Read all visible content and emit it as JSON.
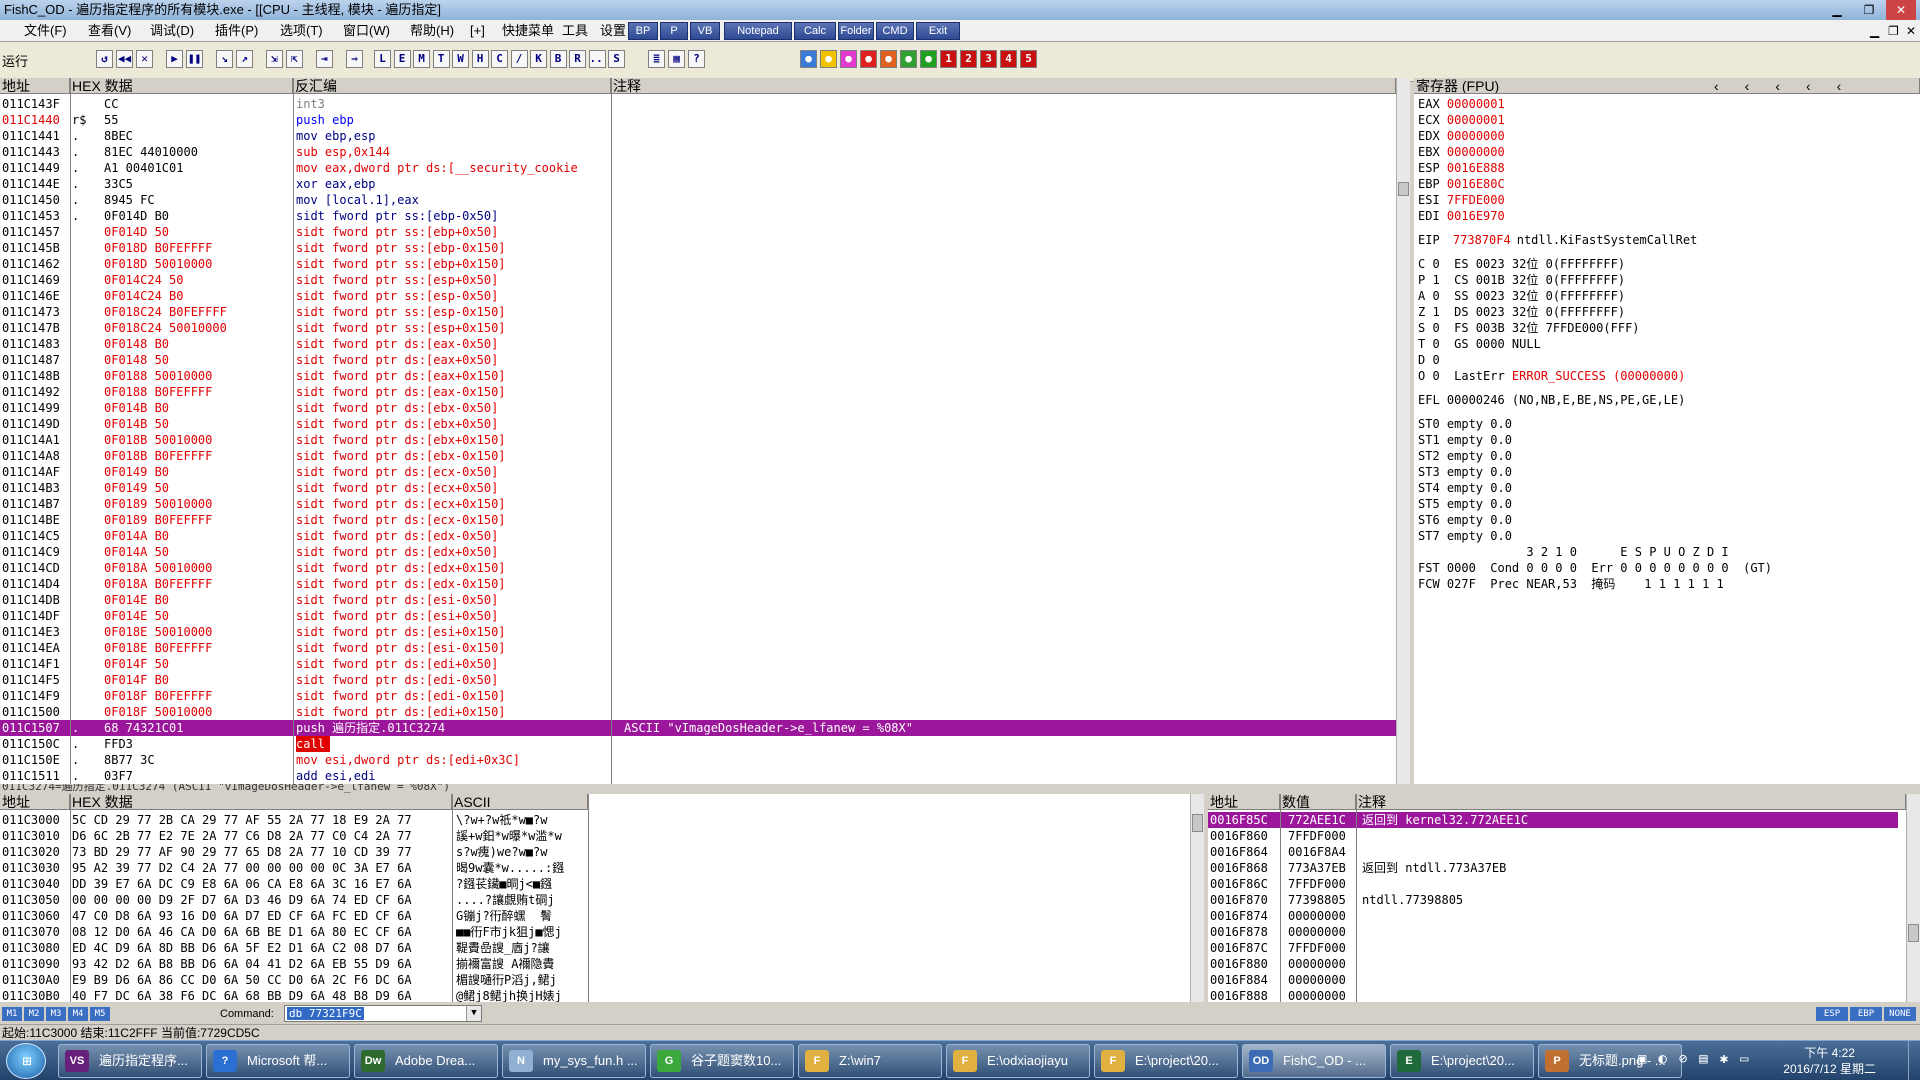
{
  "window": {
    "title": "FishC_OD - 遍历指定程序的所有模块.exe - [[CPU - 主线程, 模块 - 遍历指定]"
  },
  "menu": {
    "items": [
      "文件(F)",
      "查看(V)",
      "调试(D)",
      "插件(P)",
      "选项(T)",
      "窗口(W)",
      "帮助(H)",
      "[+]",
      "快捷菜单",
      "工具",
      "设置"
    ],
    "quick": [
      "BP",
      "P",
      "VB",
      "Notepad",
      "Calc",
      "Folder",
      "CMD",
      "Exit"
    ]
  },
  "toolbar": {
    "status": "运行",
    "letters": [
      "L",
      "E",
      "M",
      "T",
      "W",
      "H",
      "C",
      "/",
      "K",
      "B",
      "R",
      "...",
      "S"
    ],
    "numbers": [
      "1",
      "2",
      "3",
      "4",
      "5"
    ]
  },
  "disasm": {
    "headers": {
      "addr": "地址",
      "hex": "HEX 数据",
      "disasm": "反汇编",
      "comment": "注释"
    },
    "rows": [
      {
        "addr": "011C143F",
        "mark": "",
        "hex": "CC",
        "asm": "int3",
        "comment": ""
      },
      {
        "addr": "011C1440",
        "mark": "r$",
        "hex": "55",
        "asm": "push ebp",
        "comment": ""
      },
      {
        "addr": "011C1441",
        "mark": ".",
        "hex": "8BEC",
        "asm": "mov ebp,esp",
        "comment": ""
      },
      {
        "addr": "011C1443",
        "mark": ".",
        "hex": "81EC 44010000",
        "asm": "sub esp,0x144",
        "comment": ""
      },
      {
        "addr": "011C1449",
        "mark": ".",
        "hex": "A1 00401C01",
        "asm": "mov eax,dword ptr ds:[__security_cookie",
        "comment": ""
      },
      {
        "addr": "011C144E",
        "mark": ".",
        "hex": "33C5",
        "asm": "xor eax,ebp",
        "comment": ""
      },
      {
        "addr": "011C1450",
        "mark": ".",
        "hex": "8945 FC",
        "asm": "mov [local.1],eax",
        "comment": ""
      },
      {
        "addr": "011C1453",
        "mark": ".",
        "hex": "0F014D B0",
        "asm": "sidt fword ptr ss:[ebp-0x50]",
        "comment": ""
      },
      {
        "addr": "011C1457",
        "mark": "",
        "hex": "0F014D 50",
        "asm": "sidt fword ptr ss:[ebp+0x50]",
        "comment": ""
      },
      {
        "addr": "011C145B",
        "mark": "",
        "hex": "0F018D B0FEFFFF",
        "asm": "sidt fword ptr ss:[ebp-0x150]",
        "comment": ""
      },
      {
        "addr": "011C1462",
        "mark": "",
        "hex": "0F018D 50010000",
        "asm": "sidt fword ptr ss:[ebp+0x150]",
        "comment": ""
      },
      {
        "addr": "011C1469",
        "mark": "",
        "hex": "0F014C24 50",
        "asm": "sidt fword ptr ss:[esp+0x50]",
        "comment": ""
      },
      {
        "addr": "011C146E",
        "mark": "",
        "hex": "0F014C24 B0",
        "asm": "sidt fword ptr ss:[esp-0x50]",
        "comment": ""
      },
      {
        "addr": "011C1473",
        "mark": "",
        "hex": "0F018C24 B0FEFFFF",
        "asm": "sidt fword ptr ss:[esp-0x150]",
        "comment": ""
      },
      {
        "addr": "011C147B",
        "mark": "",
        "hex": "0F018C24 50010000",
        "asm": "sidt fword ptr ss:[esp+0x150]",
        "comment": ""
      },
      {
        "addr": "011C1483",
        "mark": "",
        "hex": "0F0148 B0",
        "asm": "sidt fword ptr ds:[eax-0x50]",
        "comment": ""
      },
      {
        "addr": "011C1487",
        "mark": "",
        "hex": "0F0148 50",
        "asm": "sidt fword ptr ds:[eax+0x50]",
        "comment": ""
      },
      {
        "addr": "011C148B",
        "mark": "",
        "hex": "0F0188 50010000",
        "asm": "sidt fword ptr ds:[eax+0x150]",
        "comment": ""
      },
      {
        "addr": "011C1492",
        "mark": "",
        "hex": "0F0188 B0FEFFFF",
        "asm": "sidt fword ptr ds:[eax-0x150]",
        "comment": ""
      },
      {
        "addr": "011C1499",
        "mark": "",
        "hex": "0F014B B0",
        "asm": "sidt fword ptr ds:[ebx-0x50]",
        "comment": ""
      },
      {
        "addr": "011C149D",
        "mark": "",
        "hex": "0F014B 50",
        "asm": "sidt fword ptr ds:[ebx+0x50]",
        "comment": ""
      },
      {
        "addr": "011C14A1",
        "mark": "",
        "hex": "0F018B 50010000",
        "asm": "sidt fword ptr ds:[ebx+0x150]",
        "comment": ""
      },
      {
        "addr": "011C14A8",
        "mark": "",
        "hex": "0F018B B0FEFFFF",
        "asm": "sidt fword ptr ds:[ebx-0x150]",
        "comment": ""
      },
      {
        "addr": "011C14AF",
        "mark": "",
        "hex": "0F0149 B0",
        "asm": "sidt fword ptr ds:[ecx-0x50]",
        "comment": ""
      },
      {
        "addr": "011C14B3",
        "mark": "",
        "hex": "0F0149 50",
        "asm": "sidt fword ptr ds:[ecx+0x50]",
        "comment": ""
      },
      {
        "addr": "011C14B7",
        "mark": "",
        "hex": "0F0189 50010000",
        "asm": "sidt fword ptr ds:[ecx+0x150]",
        "comment": ""
      },
      {
        "addr": "011C14BE",
        "mark": "",
        "hex": "0F0189 B0FEFFFF",
        "asm": "sidt fword ptr ds:[ecx-0x150]",
        "comment": ""
      },
      {
        "addr": "011C14C5",
        "mark": "",
        "hex": "0F014A B0",
        "asm": "sidt fword ptr ds:[edx-0x50]",
        "comment": ""
      },
      {
        "addr": "011C14C9",
        "mark": "",
        "hex": "0F014A 50",
        "asm": "sidt fword ptr ds:[edx+0x50]",
        "comment": ""
      },
      {
        "addr": "011C14CD",
        "mark": "",
        "hex": "0F018A 50010000",
        "asm": "sidt fword ptr ds:[edx+0x150]",
        "comment": ""
      },
      {
        "addr": "011C14D4",
        "mark": "",
        "hex": "0F018A B0FEFFFF",
        "asm": "sidt fword ptr ds:[edx-0x150]",
        "comment": ""
      },
      {
        "addr": "011C14DB",
        "mark": "",
        "hex": "0F014E B0",
        "asm": "sidt fword ptr ds:[esi-0x50]",
        "comment": ""
      },
      {
        "addr": "011C14DF",
        "mark": "",
        "hex": "0F014E 50",
        "asm": "sidt fword ptr ds:[esi+0x50]",
        "comment": ""
      },
      {
        "addr": "011C14E3",
        "mark": "",
        "hex": "0F018E 50010000",
        "asm": "sidt fword ptr ds:[esi+0x150]",
        "comment": ""
      },
      {
        "addr": "011C14EA",
        "mark": "",
        "hex": "0F018E B0FEFFFF",
        "asm": "sidt fword ptr ds:[esi-0x150]",
        "comment": ""
      },
      {
        "addr": "011C14F1",
        "mark": "",
        "hex": "0F014F 50",
        "asm": "sidt fword ptr ds:[edi+0x50]",
        "comment": ""
      },
      {
        "addr": "011C14F5",
        "mark": "",
        "hex": "0F014F B0",
        "asm": "sidt fword ptr ds:[edi-0x50]",
        "comment": ""
      },
      {
        "addr": "011C14F9",
        "mark": "",
        "hex": "0F018F B0FEFFFF",
        "asm": "sidt fword ptr ds:[edi-0x150]",
        "comment": ""
      },
      {
        "addr": "011C1500",
        "mark": "",
        "hex": "0F018F 50010000",
        "asm": "sidt fword ptr ds:[edi+0x150]",
        "comment": ""
      },
      {
        "addr": "011C1507",
        "mark": ".",
        "hex": "68 74321C01",
        "asm": "push 遍历指定.011C3274",
        "comment": "ASCII \"vImageDosHeader->e_lfanew = %08X\""
      },
      {
        "addr": "011C150C",
        "mark": ".",
        "hex": "FFD3",
        "asm": "call ebx",
        "comment": ""
      },
      {
        "addr": "011C150E",
        "mark": ".",
        "hex": "8B77 3C",
        "asm": "mov esi,dword ptr ds:[edi+0x3C]",
        "comment": ""
      },
      {
        "addr": "011C1511",
        "mark": ".",
        "hex": "03F7",
        "asm": "add esi,edi",
        "comment": ""
      }
    ],
    "info": "011C3274=遍历指定.011C3274 (ASCII \"vImageDosHeader->e_lfanew = %08X\")"
  },
  "registers": {
    "header": "寄存器 (FPU)",
    "gpr": [
      {
        "name": "EAX",
        "value": "00000001"
      },
      {
        "name": "ECX",
        "value": "00000001"
      },
      {
        "name": "EDX",
        "value": "00000000"
      },
      {
        "name": "EBX",
        "value": "00000000"
      },
      {
        "name": "ESP",
        "value": "0016E888"
      },
      {
        "name": "EBP",
        "value": "0016E80C"
      },
      {
        "name": "ESI",
        "value": "7FFDE000"
      },
      {
        "name": "EDI",
        "value": "0016E970"
      }
    ],
    "eip": {
      "name": "EIP",
      "value": "773870F4",
      "sym": "ntdll.KiFastSystemCallRet"
    },
    "flags": [
      "C 0  ES 0023 32位 0(FFFFFFFF)",
      "P 1  CS 001B 32位 0(FFFFFFFF)",
      "A 0  SS 0023 32位 0(FFFFFFFF)",
      "Z 1  DS 0023 32位 0(FFFFFFFF)",
      "S 0  FS 003B 32位 7FFDE000(FFF)",
      "T 0  GS 0000 NULL",
      "D 0"
    ],
    "lasterr": {
      "prefix": "O 0  LastErr ",
      "value": "ERROR_SUCCESS (00000000)"
    },
    "efl": "EFL 00000246 (NO,NB,E,BE,NS,PE,GE,LE)",
    "fpu": [
      "ST0 empty 0.0",
      "ST1 empty 0.0",
      "ST2 empty 0.0",
      "ST3 empty 0.0",
      "ST4 empty 0.0",
      "ST5 empty 0.0",
      "ST6 empty 0.0",
      "ST7 empty 0.0"
    ],
    "fpu_hdr": "               3 2 1 0      E S P U O Z D I",
    "fst": "FST 0000  Cond 0 0 0 0  Err 0 0 0 0 0 0 0 0  (GT)",
    "fcw": "FCW 027F  Prec NEAR,53  掩码    1 1 1 1 1 1"
  },
  "dump": {
    "headers": {
      "addr": "地址",
      "hex": "HEX 数据",
      "ascii": "ASCII"
    },
    "rows": [
      {
        "addr": "011C3000",
        "hex": "5C CD 29 77 2B CA 29 77 AF 55 2A 77 18 E9 2A 77",
        "ascii": "\\?w+?w祗*w■?w"
      },
      {
        "addr": "011C3010",
        "hex": "D6 6C 2B 77 E2 7E 2A 77 C6 D8 2A 77 C0 C4 2A 77",
        "ascii": "謑+w鈤*w曝*w滥*w"
      },
      {
        "addr": "011C3020",
        "hex": "73 BD 29 77 AF 90 29 77 65 D8 2A 77 10 CD 39 77",
        "ascii": "s?w瘣)we?w■?w"
      },
      {
        "addr": "011C3030",
        "hex": "95 A2 39 77 D2 C4 2A 77 00 00 00 00 0C 3A E7 6A",
        "ascii": "暍9w囊*w.....:鏹"
      },
      {
        "addr": "011C3040",
        "hex": "DD 39 E7 6A DC C9 E8 6A 06 CA E8 6A 3C 16 E7 6A",
        "ascii": "?鏹苌鑶■晍j<■鏹"
      },
      {
        "addr": "011C3050",
        "hex": "00 00 00 00 D9 2F D7 6A D3 46 D9 6A 74 ED CF 6A",
        "ascii": "....?讓覷贿t硐j"
      },
      {
        "addr": "011C3060",
        "hex": "47 C0 D8 6A 93 16 D0 6A D7 ED CF 6A FC ED CF 6A",
        "ascii": "G镚j?衎醉蟔  鬌"
      },
      {
        "addr": "011C3070",
        "hex": "08 12 D0 6A 46 CA D0 6A 6B BE D1 6A 80 EC CF 6A",
        "ascii": "■■衎F市jk狙j■愢j"
      },
      {
        "addr": "011C3080",
        "hex": "ED 4C D9 6A 8D BB D6 6A 5F E2 D1 6A C2 08 D7 6A",
        "ascii": "鞮賮嵒謏_庮j?讓"
      },
      {
        "addr": "011C3090",
        "hex": "93 42 D2 6A B8 BB D6 6A 04 41 D2 6A EB 55 D9 6A",
        "ascii": "揃襧富謏 A襧隐賮"
      },
      {
        "addr": "011C30A0",
        "hex": "E9 B9 D6 6A 86 CC D0 6A 50 CC D0 6A 2C F6 DC 6A",
        "ascii": "楣謏嗵衎P滔j,鲪j"
      },
      {
        "addr": "011C30B0",
        "hex": "40 F7 DC 6A 38 F6 DC 6A 68 BB D9 6A 48 B8 D9 6A",
        "ascii": "@鲪j8鲪jh换jH婊j"
      }
    ]
  },
  "stack": {
    "headers": {
      "addr": "地址",
      "value": "数值",
      "comment": "注释"
    },
    "rows": [
      {
        "addr": "0016F85C",
        "value": "772AEE1C",
        "comment": "返回到 kernel32.772AEE1C",
        "hl": true
      },
      {
        "addr": "0016F860",
        "value": "7FFDF000",
        "comment": ""
      },
      {
        "addr": "0016F864",
        "value": "0016F8A4",
        "comment": ""
      },
      {
        "addr": "0016F868",
        "value": "773A37EB",
        "comment": "返回到 ntdll.773A37EB"
      },
      {
        "addr": "0016F86C",
        "value": "7FFDF000",
        "comment": ""
      },
      {
        "addr": "0016F870",
        "value": "77398805",
        "comment": "ntdll.77398805"
      },
      {
        "addr": "0016F874",
        "value": "00000000",
        "comment": ""
      },
      {
        "addr": "0016F878",
        "value": "00000000",
        "comment": ""
      },
      {
        "addr": "0016F87C",
        "value": "7FFDF000",
        "comment": ""
      },
      {
        "addr": "0016F880",
        "value": "00000000",
        "comment": ""
      },
      {
        "addr": "0016F884",
        "value": "00000000",
        "comment": ""
      },
      {
        "addr": "0016F888",
        "value": "00000000",
        "comment": ""
      }
    ]
  },
  "command": {
    "label": "Command:",
    "value": "db 77321F9C",
    "tabs": [
      "M1",
      "M2",
      "M3",
      "M4",
      "M5"
    ],
    "right_tabs": [
      "ESP",
      "EBP",
      "NONE"
    ]
  },
  "statusbar": {
    "text": "起始:11C3000 结束:11C2FFF 当前值:7729CD5C"
  },
  "taskbar": {
    "tasks": [
      {
        "label": "遍历指定程序...",
        "icon": "VS"
      },
      {
        "label": "Microsoft 帮...",
        "icon": "?"
      },
      {
        "label": "Adobe Drea...",
        "icon": "Dw"
      },
      {
        "label": "my_sys_fun.h ...",
        "icon": "N"
      },
      {
        "label": "谷子题窦数10...",
        "icon": "G"
      },
      {
        "label": "Z:\\win7",
        "icon": "F"
      },
      {
        "label": "E:\\odxiaojiayu",
        "icon": "F"
      },
      {
        "label": "E:\\project\\20...",
        "icon": "F"
      },
      {
        "label": "FishC_OD - ...",
        "icon": "OD"
      },
      {
        "label": "E:\\project\\20...",
        "icon": "E"
      },
      {
        "label": "无标题.png - ...",
        "icon": "P"
      }
    ],
    "time": "下午 4:22",
    "date": "2016/7/12 星期二"
  }
}
